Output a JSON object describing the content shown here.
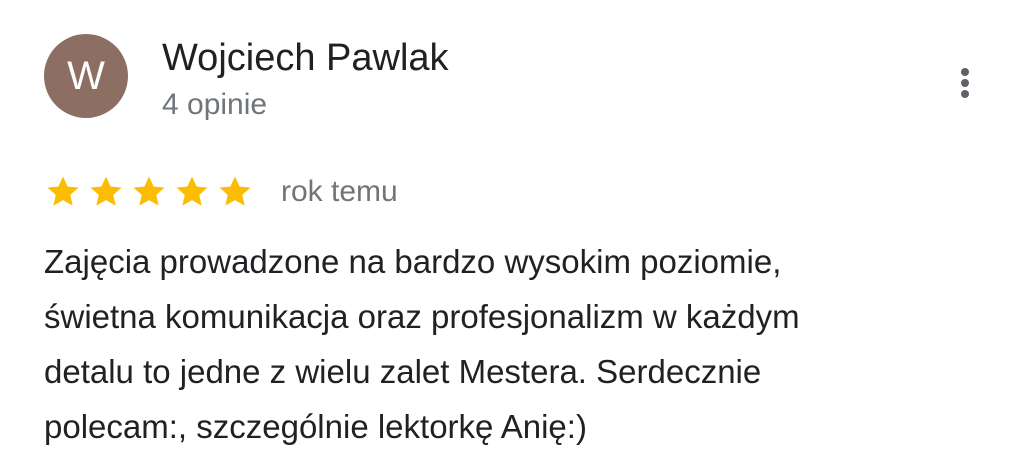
{
  "author": {
    "initial": "W",
    "name": "Wojciech Pawlak",
    "review_count": "4 opinie",
    "avatar_color": "#8d6e63"
  },
  "menu": {
    "icon": "more-vert-icon"
  },
  "rating": {
    "stars": 5,
    "max_stars": 5,
    "star_color": "#fbbc04",
    "time_ago": "rok temu"
  },
  "review": {
    "lines": [
      "Zajęcia prowadzone na bardzo wysokim poziomie,",
      "świetna komunikacja oraz profesjonalizm w każdym",
      "detalu to jedne z wielu zalet Mestera. Serdecznie",
      "polecam:, szczególnie lektorkę Anię:)"
    ]
  }
}
